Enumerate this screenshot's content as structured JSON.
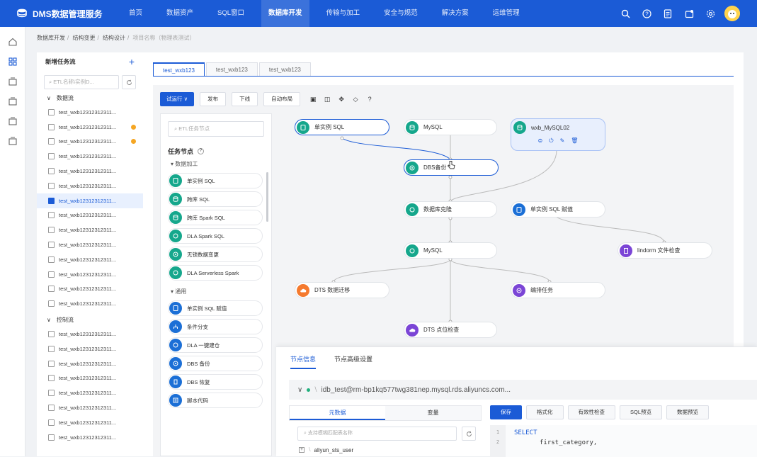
{
  "header": {
    "brand": "DMS数据管理服务",
    "nav": [
      {
        "label": "首页"
      },
      {
        "label": "数据资产"
      },
      {
        "label": "SQL窗口"
      },
      {
        "label": "数据库开发"
      },
      {
        "label": "传输与加工"
      },
      {
        "label": "安全与规范"
      },
      {
        "label": "解决方案"
      },
      {
        "label": "运维管理"
      }
    ],
    "active_nav": "数据库开发",
    "icons": [
      "search-icon",
      "help-icon",
      "document-icon",
      "notification-icon",
      "settings-icon",
      "avatar"
    ]
  },
  "breadcrumb": {
    "items": [
      "数据库开发",
      "结构变更",
      "结构设计"
    ],
    "last": "项目名称（物理表测试）"
  },
  "tree": {
    "title": "新增任务流",
    "search_placeholder": "ETL名称\\实例D...",
    "group_data": "数据流",
    "group_control": "控制流",
    "items": [
      "test_wxb12312312311...",
      "test_wxb12312312311...",
      "test_wxb12312312311...",
      "test_wxb12312312311...",
      "test_wxb12312312311...",
      "test_wxb12312312311...",
      "test_wxb12312312311...",
      "test_wxb12312312311...",
      "test_wxb12312312311...",
      "test_wxb12312312311...",
      "test_wxb12312312311...",
      "test_wxb12312312311...",
      "test_wxb12312312311...",
      "test_wxb12312312311...",
      "test_wxb12312312311...",
      "test_wxb12312312311...",
      "test_wxb12312312311...",
      "test_wxb12312312311...",
      "test_wxb12312312311...",
      "test_wxb12312312311...",
      "test_wxb12312312311...",
      "test_wxb12312312311..."
    ]
  },
  "tabs": [
    "test_wxb123",
    "test_wxb123",
    "test_wxb123"
  ],
  "toolbar": {
    "run": "试运行",
    "publish": "发布",
    "offline": "下线",
    "auto_layout": "自动布局"
  },
  "node_panel": {
    "search_placeholder": "ETL任务节点",
    "title": "任务节点",
    "group_processing": "数据加工",
    "group_general": "通用",
    "processing_nodes": [
      "单实例 SQL",
      "跨库 SQL",
      "跨库 Spark SQL",
      "DLA Spark SQL",
      "无锁数据变更",
      "DLA Serverless Spark"
    ],
    "general_nodes": [
      "单实例 SQL 赋值",
      "条件分支",
      "DLA 一键建仓",
      "DBS 备份",
      "DBS 恢复",
      "脚本代码"
    ]
  },
  "flow": {
    "n1": "单实例 SQL",
    "n2": "MySQL",
    "n3": "wxb_MySQL02",
    "n4": "DBS备份",
    "n5": "数据库克隆",
    "n6": "单实例 SQL 赋值",
    "n7": "MySQL",
    "n8": "lindorm 文件检查",
    "n9": "DTS 数据迁移",
    "n10": "编排任务",
    "n11": "DTS 点位检查"
  },
  "bottom": {
    "tab_info": "节点信息",
    "tab_advanced": "节点高级设置",
    "connection": "idb_test@rm-bp1kq577twg381nep.mysql.rds.aliyuncs.com...",
    "meta_tab": "元数据",
    "var_tab": "变量",
    "table_search_placeholder": "支持模糊匹配表名称",
    "db_name": "aliyun_sts_user",
    "editor_buttons": [
      "保存",
      "格式化",
      "有效性检查",
      "SQL预览",
      "数据预览"
    ],
    "code_line1": "SELECT",
    "code_line2": "first_category,",
    "line1": "1",
    "line2": "2"
  },
  "colors": {
    "brand": "#1b5bd6",
    "teal": "#15a78c",
    "blue": "#1b6fd6",
    "orange": "#f57a2e",
    "purple": "#7b45d6"
  }
}
